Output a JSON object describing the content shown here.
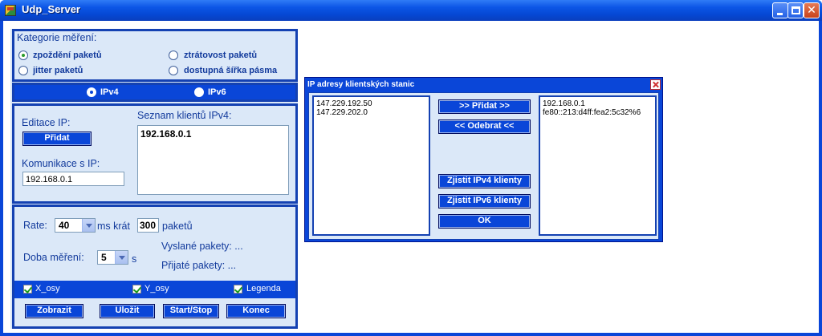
{
  "window": {
    "title": "Udp_Server"
  },
  "measurement": {
    "title": "Kategorie měření:",
    "options": [
      "zpoždění paketů",
      "ztrátovost paketů",
      "jitter paketů",
      "dostupná šířka pásma"
    ],
    "selected": "zpoždění paketů"
  },
  "ipversion": {
    "ipv4": "IPv4",
    "ipv6": "IPv6",
    "selected": "IPv4"
  },
  "edit": {
    "edit_label": "Editace IP:",
    "add_button": "Přidat",
    "comm_label": "Komunikace s IP:",
    "comm_value": "192.168.0.1",
    "clients_label": "Seznam klientů IPv4:",
    "clients": [
      "192.168.0.1"
    ]
  },
  "rate": {
    "rate_label": "Rate:",
    "rate_value": "40",
    "ms_label": "ms krát",
    "count_value": "300",
    "packets_label": "paketů",
    "sent_label": "Vyslané pakety: ...",
    "duration_label": "Doba měření:",
    "duration_value": "5",
    "duration_unit": "s",
    "received_label": "Přijaté pakety: ..."
  },
  "checks": {
    "x": "X_osy",
    "y": "Y_osy",
    "legend": "Legenda"
  },
  "buttons": {
    "show": "Zobrazit",
    "save": "Uložit",
    "startstop": "Start/Stop",
    "end": "Konec"
  },
  "dialog": {
    "title": "IP adresy klientských stanic",
    "left_list": [
      "147.229.192.50",
      "147.229.202.0"
    ],
    "right_list": [
      "192.168.0.1",
      "fe80::213:d4ff:fea2:5c32%6"
    ],
    "add": ">> Přidat >>",
    "remove": "<< Odebrat <<",
    "find4": "Zjistit IPv4 klienty",
    "find6": "Zjistit IPv6 klienty",
    "ok": "OK"
  }
}
